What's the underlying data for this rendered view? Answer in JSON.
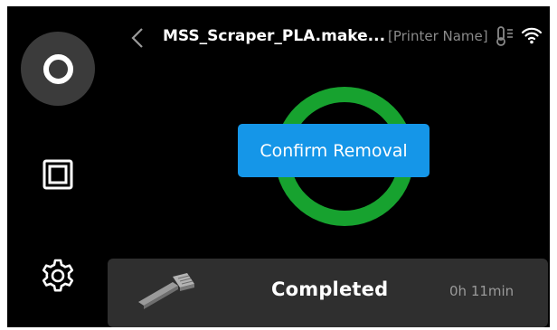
{
  "header": {
    "file_name": "MSS_Scraper_PLA.make...",
    "printer_name": "[Printer Name]"
  },
  "nav": {
    "items": [
      {
        "icon": "home-icon",
        "active": true
      },
      {
        "icon": "files-icon",
        "active": false
      },
      {
        "icon": "gear-icon",
        "active": false
      }
    ]
  },
  "progress": {
    "percent": 100,
    "color": "#17a22f"
  },
  "dialog": {
    "confirm_label": "Confirm Removal",
    "color": "#1596e8"
  },
  "status": {
    "label": "Completed",
    "elapsed": "0h 11min",
    "thumbnail_icon": "scraper-model-icon"
  }
}
